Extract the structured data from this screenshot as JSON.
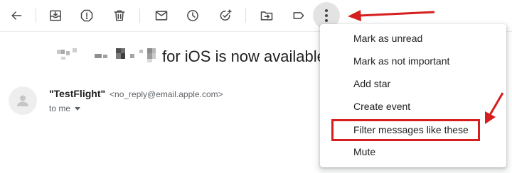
{
  "toolbar": {
    "icons": [
      "back-icon",
      "archive-icon",
      "report-spam-icon",
      "delete-icon",
      "mark-unread-icon",
      "snooze-icon",
      "add-to-tasks-icon",
      "move-to-icon",
      "label-icon",
      "more-options-icon"
    ]
  },
  "email": {
    "subject_suffix": "for iOS is now available",
    "sender_name": "\"TestFlight\"",
    "sender_email": "<no_reply@email.apple.com>",
    "recipient": "to me"
  },
  "menu": {
    "items": [
      {
        "label": "Mark as unread"
      },
      {
        "label": "Mark as not important"
      },
      {
        "label": "Add star"
      },
      {
        "label": "Create event"
      },
      {
        "label": "Filter messages like these"
      },
      {
        "label": "Mute"
      }
    ]
  },
  "annotation_color": "#d61e1e"
}
